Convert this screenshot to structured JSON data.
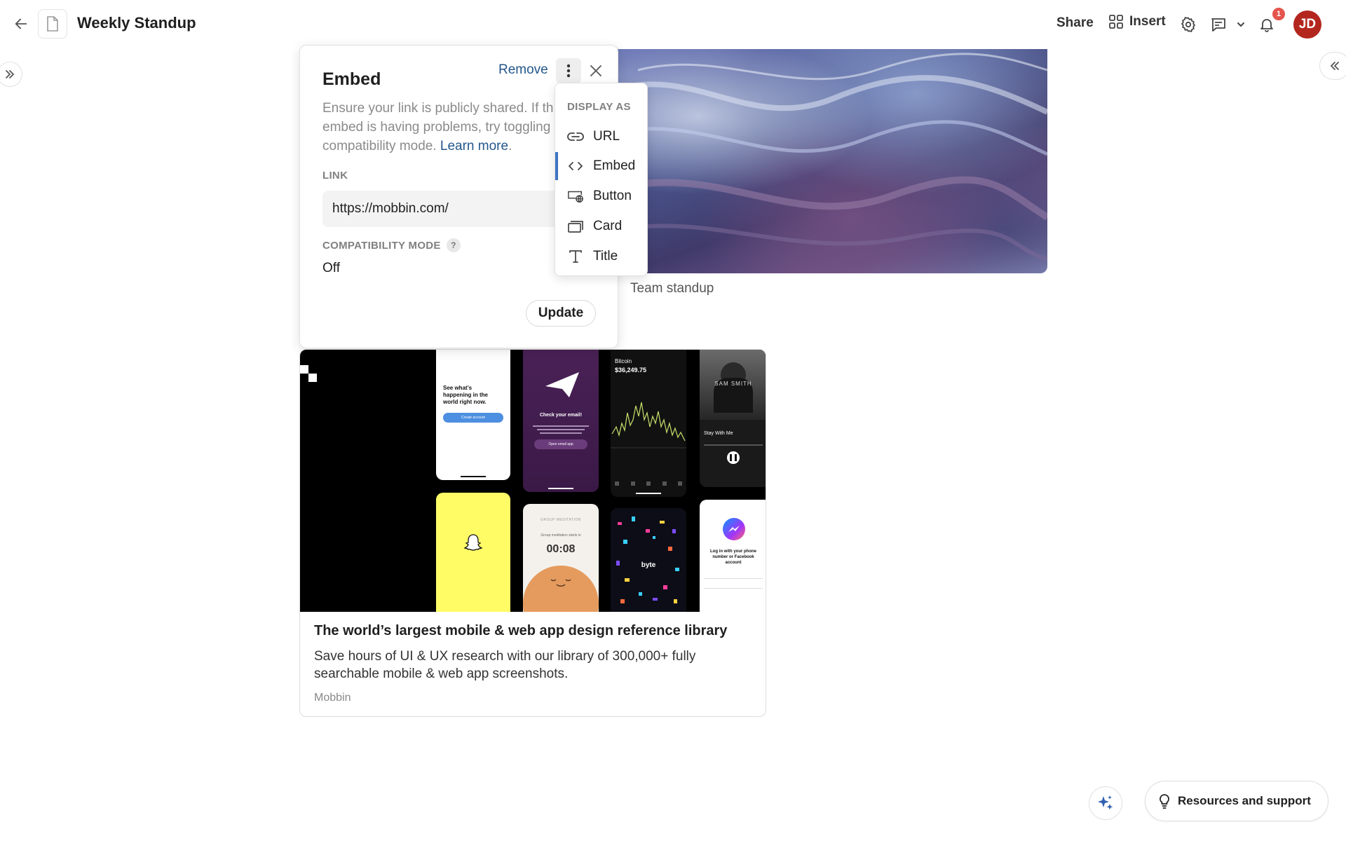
{
  "header": {
    "doc_title": "Weekly Standup",
    "share_label": "Share",
    "insert_label": "Insert",
    "notification_count": "1",
    "avatar_initials": "JD"
  },
  "hero": {
    "caption": "Team standup"
  },
  "embed_popover": {
    "title": "Embed",
    "remove_label": "Remove",
    "description_line1": "Ensure your link is publicly shared. If th",
    "description_line2": "embed is having problems, try toggling",
    "description_line3": "compatibility mode.",
    "learn_more": "Learn more",
    "link_label": "LINK",
    "link_value": "https://mobbin.com/",
    "compat_label": "COMPATIBILITY MODE",
    "compat_help": "?",
    "compat_value": "Off",
    "update_label": "Update"
  },
  "display_as": {
    "heading": "DISPLAY AS",
    "items": [
      {
        "label": "URL",
        "icon": "link-icon"
      },
      {
        "label": "Embed",
        "icon": "code-icon",
        "active": true
      },
      {
        "label": "Button",
        "icon": "button-globe-icon"
      },
      {
        "label": "Card",
        "icon": "card-icon"
      },
      {
        "label": "Title",
        "icon": "text-icon"
      }
    ]
  },
  "preview_card": {
    "title": "The world’s largest mobile & web app design reference library",
    "description": "Save hours of UI & UX research with our library of 300,000+ fully searchable mobile & web app screenshots.",
    "source": "Mobbin",
    "screens": {
      "twitter_line1": "See what’s",
      "twitter_line2": "happening in the",
      "twitter_line3": "world right now.",
      "twitter_button": "Create account",
      "email_title": "Check your email!",
      "email_button": "Open email app",
      "bitcoin_label": "Bitcoin",
      "bitcoin_price": "$36,249.75",
      "music_song": "Stay With Me",
      "music_artist": "SAM SMITH",
      "meditation_header": "GROUP MEDITATION",
      "meditation_text": "Group meditation starts in",
      "meditation_timer": "00:08",
      "byte_label": "byte",
      "messenger_text": "Log in with your phone number or Facebook account"
    }
  },
  "bottom": {
    "resources_label": "Resources and support"
  },
  "colors": {
    "accent_link": "#24578c",
    "active_indicator": "#3d73c4",
    "badge": "#e5544d",
    "avatar": "#b3261e"
  }
}
